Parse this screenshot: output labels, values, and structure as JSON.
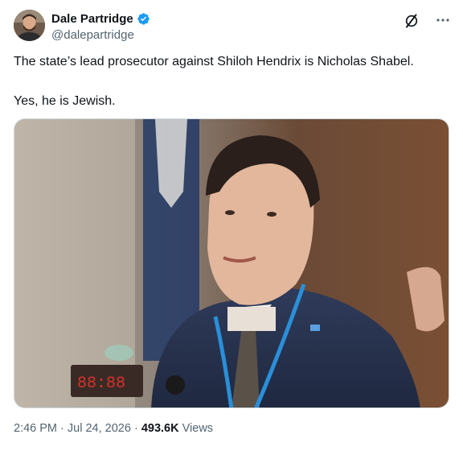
{
  "author": {
    "display_name": "Dale Partridge",
    "handle": "@dalepartridge",
    "verified": true,
    "avatar_icon": "person-avatar"
  },
  "header_actions": {
    "grok_icon": "grok-icon",
    "more_icon": "more-icon"
  },
  "tweet": {
    "paragraph1": "The state’s lead prosecutor against Shiloh Hendrix is Nicholas Shabel.",
    "paragraph2": "Yes, he is Jewish."
  },
  "media": {
    "type": "photo"
  },
  "meta": {
    "time": "2:46 PM",
    "separator": "·",
    "date": "Jul 24, 2026",
    "views_count": "493.6K",
    "views_label": "Views"
  },
  "colors": {
    "text": "#0f1419",
    "secondary": "#536471",
    "verified_blue": "#1d9bf0",
    "border": "#cfd9de"
  }
}
